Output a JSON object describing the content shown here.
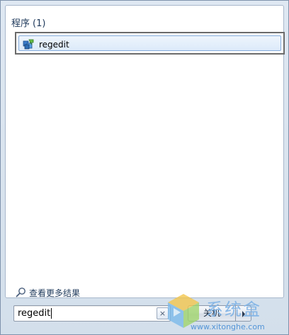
{
  "results": {
    "section_title": "程序",
    "section_count": "(1)",
    "items": [
      {
        "label": "regedit",
        "icon": "registry-editor-icon"
      }
    ]
  },
  "see_more": {
    "label": "查看更多结果",
    "icon": "search-icon"
  },
  "search": {
    "value": "regedit",
    "clear_icon": "close-icon",
    "clear_glyph": "×"
  },
  "shutdown": {
    "label": "关机",
    "arrow_icon": "chevron-right-icon"
  },
  "watermark": {
    "text": "系统盒",
    "url": "www.xitonghe.com"
  },
  "colors": {
    "accent": "#1e395b",
    "selection_border": "#84acdd",
    "focus_border": "#6b6b6b"
  }
}
